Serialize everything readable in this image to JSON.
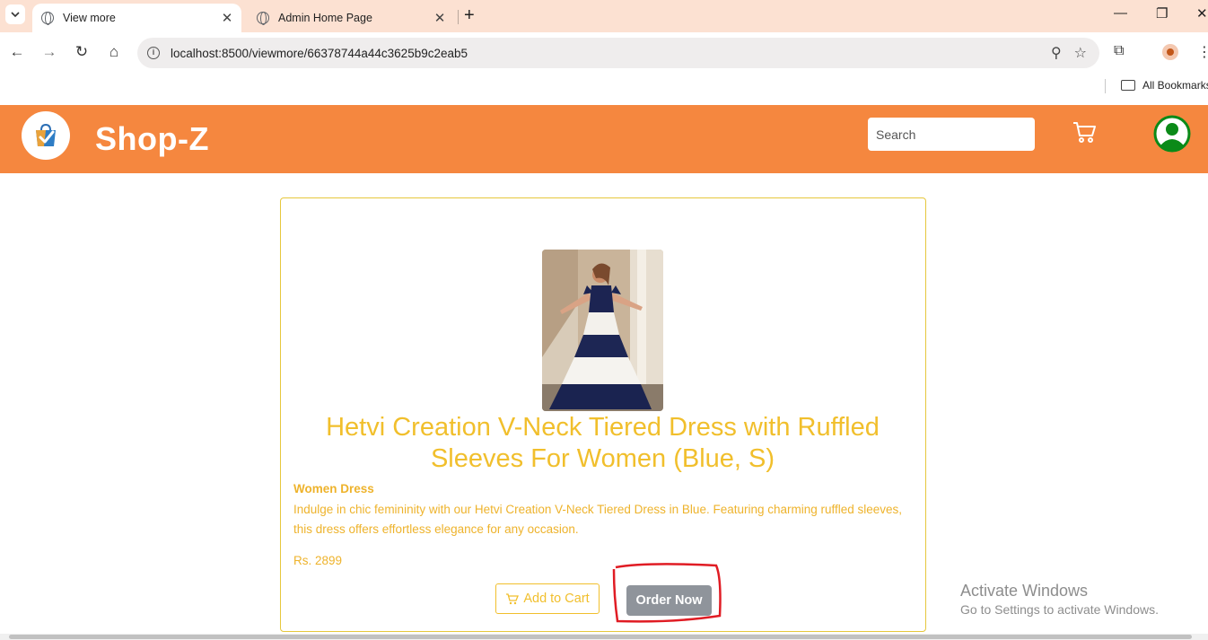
{
  "browser": {
    "tabs": [
      {
        "title": "View more",
        "active": true
      },
      {
        "title": "Admin Home Page",
        "active": false
      }
    ],
    "url": "localhost:8500/viewmore/66378744a44c3625b9c2eab5",
    "bookmarks_label": "All Bookmarks"
  },
  "header": {
    "brand": "Shop-Z",
    "search_placeholder": "Search",
    "accent_color": "#f5873f"
  },
  "product": {
    "title": "Hetvi Creation V-Neck Tiered Dress with Ruffled Sleeves For Women (Blue, S)",
    "category": "Women Dress",
    "description": "Indulge in chic femininity with our Hetvi Creation V-Neck Tiered Dress in Blue. Featuring charming ruffled sleeves, this dress offers effortless elegance for any occasion.",
    "price": "Rs. 2899",
    "add_to_cart_label": "Add to Cart",
    "order_now_label": "Order Now",
    "text_color": "#f1bf2c"
  },
  "watermark": {
    "title": "Activate Windows",
    "subtitle": "Go to Settings to activate Windows."
  },
  "icons": {
    "cart": "shopping-cart-icon",
    "user": "user-avatar-icon",
    "logo": "shopping-bag-check-icon"
  }
}
